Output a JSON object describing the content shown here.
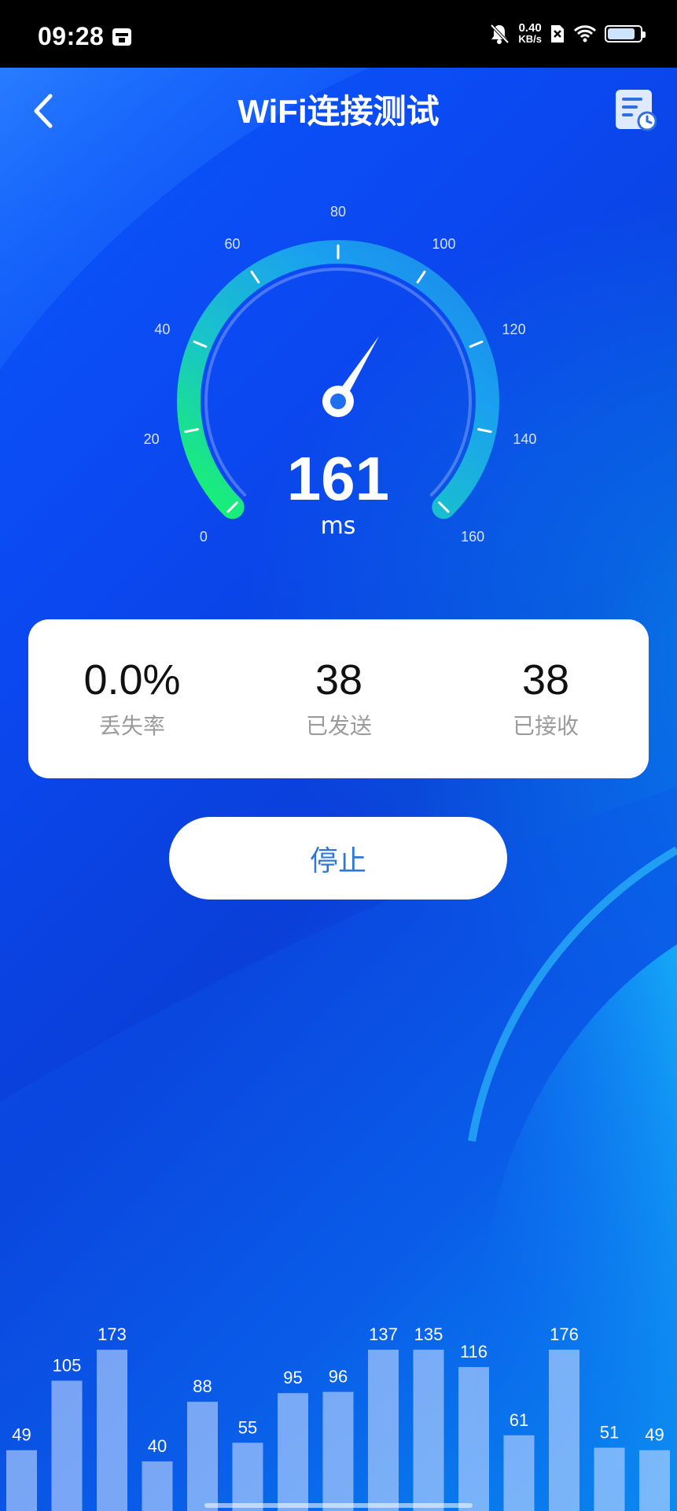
{
  "status_bar": {
    "time": "09:28",
    "net_speed_value": "0.40",
    "net_speed_unit": "KB/s",
    "battery_level": 0.85
  },
  "header": {
    "title": "WiFi连接测试",
    "back_icon": "chevron-left-icon",
    "history_icon": "history-list-icon"
  },
  "gauge": {
    "value": "161",
    "unit": "ms",
    "min": 0,
    "max": 160,
    "ticks": [
      "0",
      "20",
      "40",
      "60",
      "80",
      "100",
      "120",
      "140",
      "160"
    ],
    "needle_value": 99,
    "colors": {
      "start": "#19f56a",
      "mid": "#19a8ee",
      "end": "#1c86ea"
    }
  },
  "stats": [
    {
      "value": "0.0%",
      "label": "丢失率"
    },
    {
      "value": "38",
      "label": "已发送"
    },
    {
      "value": "38",
      "label": "已接收"
    }
  ],
  "controls": {
    "stop_label": "停止"
  },
  "chart_data": {
    "type": "bar",
    "values": [
      49,
      105,
      173,
      40,
      88,
      55,
      95,
      96,
      137,
      135,
      116,
      61,
      176,
      51,
      49
    ],
    "labels": [
      "49",
      "105",
      "173",
      "40",
      "88",
      "55",
      "95",
      "96",
      "137",
      "135",
      "116",
      "61",
      "176",
      "51",
      "49"
    ]
  }
}
